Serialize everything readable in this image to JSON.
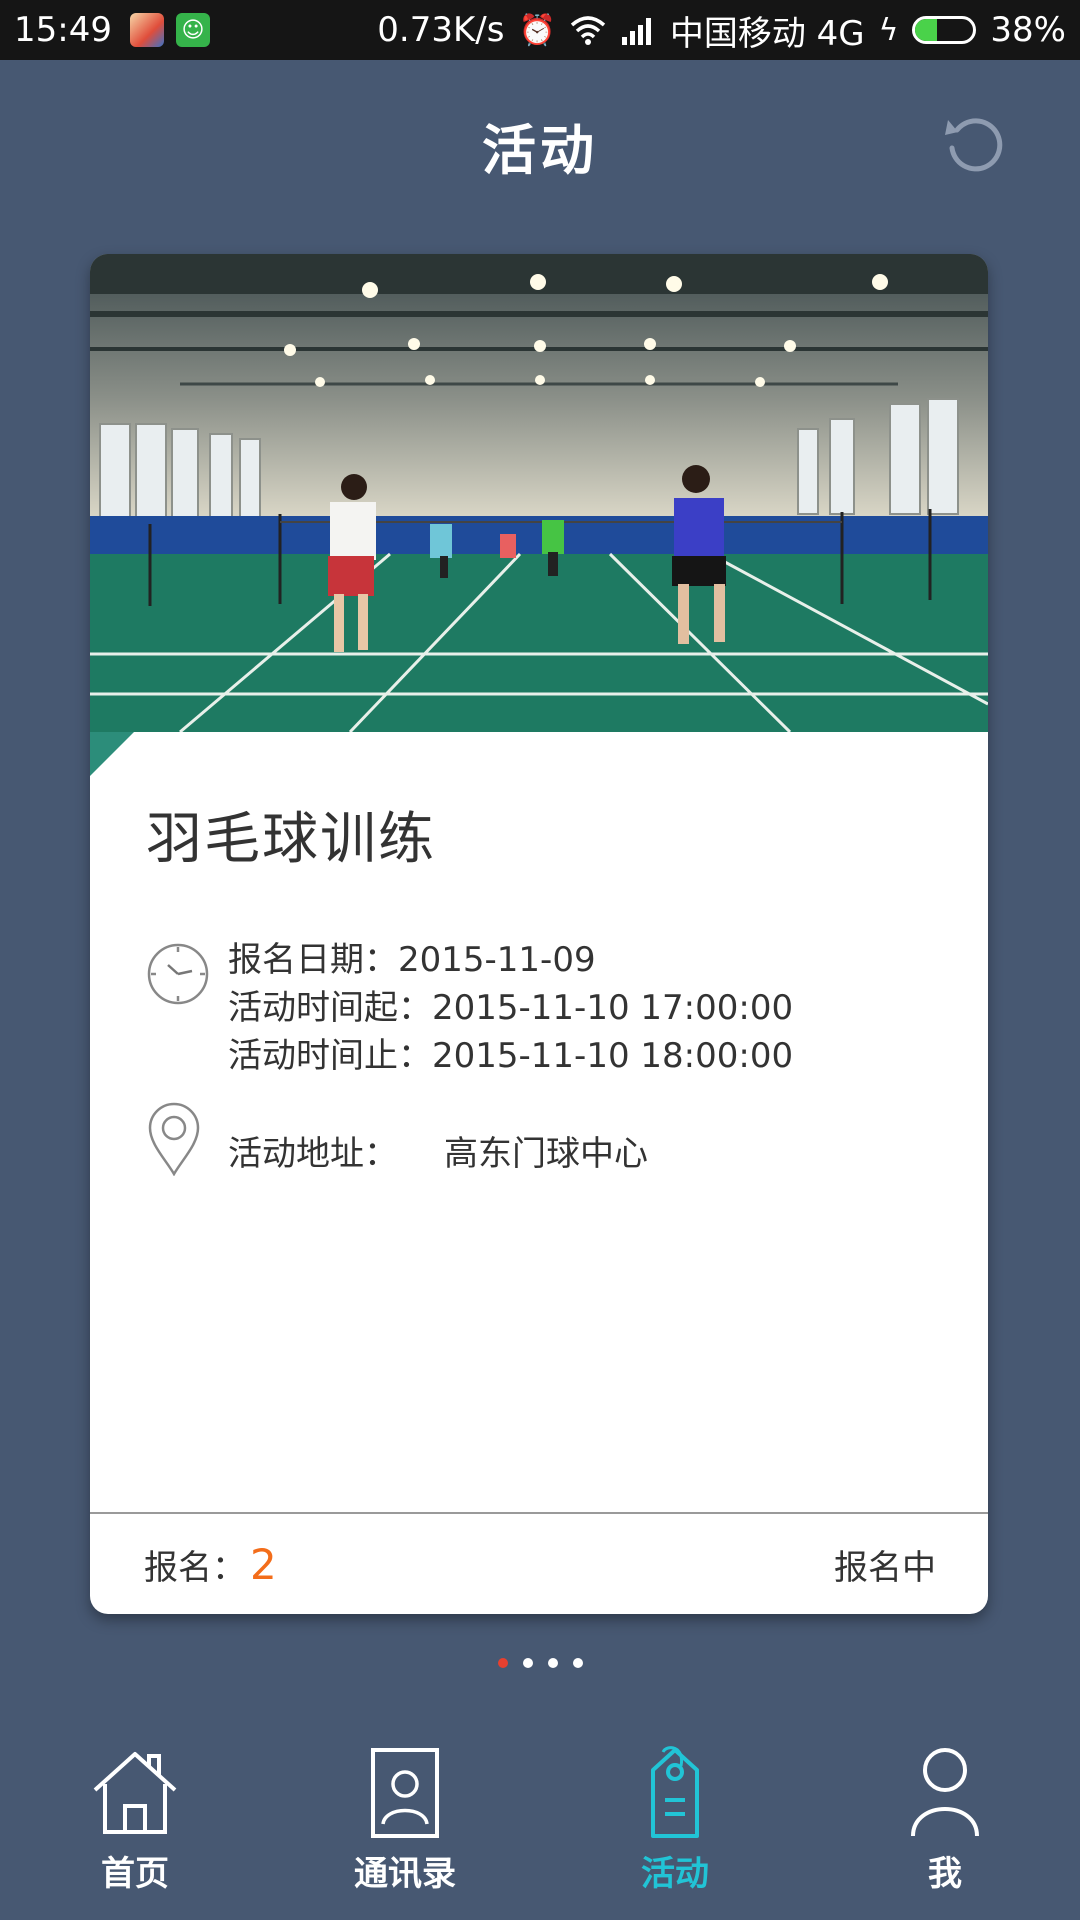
{
  "status_bar": {
    "time": "15:49",
    "network_speed": "0.73K/s",
    "carrier": "中国移动 4G",
    "battery_percent": "38%",
    "battery_level": 0.38,
    "icons": [
      "app-icon",
      "android-icon",
      "alarm-icon",
      "wifi-icon",
      "signal-icon",
      "charging-icon",
      "battery-icon"
    ]
  },
  "header": {
    "title": "活动",
    "refresh_icon": "refresh-icon"
  },
  "activity": {
    "title": "羽毛球训练",
    "signup_date": "报名日期：2015-11-09",
    "start_time": "活动时间起：2015-11-10 17:00:00",
    "end_time": "活动时间止：2015-11-10 18:00:00",
    "address_label": "活动地址：",
    "address_value": "高东门球中心",
    "signup_label": "报名：",
    "signup_count": "2",
    "status": "报名中",
    "image": "badminton-court-photo"
  },
  "pager": {
    "count": 4,
    "active_index": 0
  },
  "nav": {
    "items": [
      {
        "label": "首页",
        "icon": "home-icon",
        "active": false
      },
      {
        "label": "通讯录",
        "icon": "contacts-icon",
        "active": false
      },
      {
        "label": "活动",
        "icon": "tag-icon",
        "active": true
      },
      {
        "label": "我",
        "icon": "person-icon",
        "active": false
      }
    ]
  },
  "colors": {
    "background": "#475872",
    "accent": "#21c4d6",
    "count": "#f36d1a",
    "active_dot": "#e8402f"
  }
}
